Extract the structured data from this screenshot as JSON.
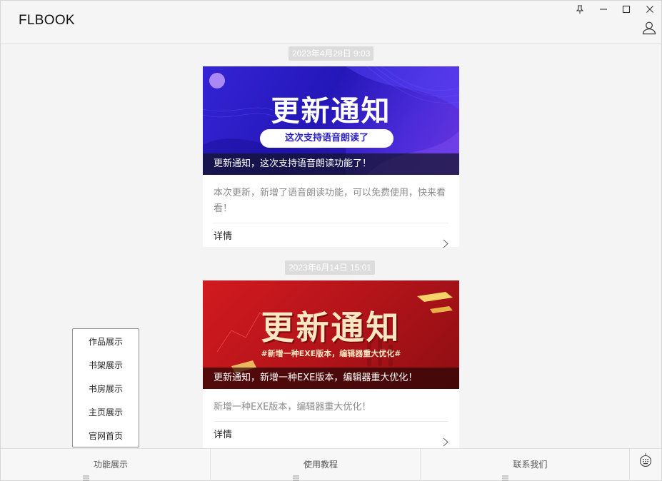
{
  "app": {
    "title": "FLBOOK"
  },
  "feed": {
    "cards": [
      {
        "timestamp": "2023年4月28日 9:03",
        "banner_title": "更新通知",
        "banner_subtitle": "这次支持语音朗读了",
        "caption": "更新通知，这次支持语音朗读功能了！",
        "description": "本次更新，新增了语音朗读功能，可以免费使用，快来看看！",
        "detail_label": "详情"
      },
      {
        "timestamp": "2023年6月14日 15:01",
        "banner_title": "更新通知",
        "banner_subtitle": "#新增一种EXE版本，编辑器重大优化#",
        "caption": "更新通知，新增一种EXE版本，编辑器重大优化！",
        "description": "新增一种EXE版本，编辑器重大优化！",
        "detail_label": "详情"
      }
    ]
  },
  "popup_menu": {
    "items": [
      "作品展示",
      "书架展示",
      "书房展示",
      "主页展示",
      "官网首页"
    ]
  },
  "bottom_tabs": [
    "功能展示",
    "使用教程",
    "联系我们"
  ],
  "colors": {
    "banner1_bg": "#2a1fc4",
    "banner2_bg": "#b3141a",
    "badge_bg": "#dcdcdc"
  }
}
